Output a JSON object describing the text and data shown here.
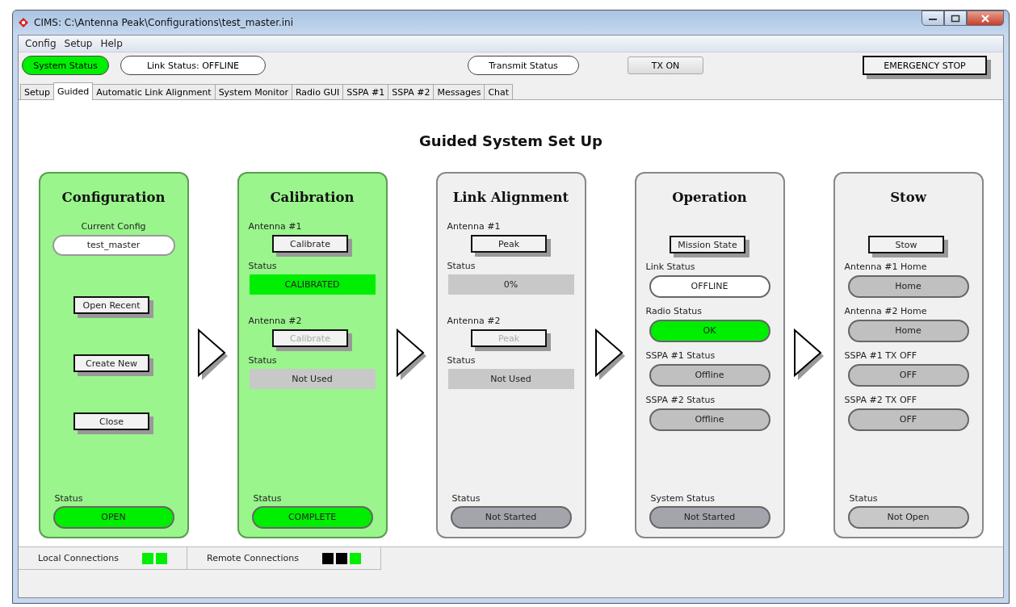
{
  "window": {
    "title": "CIMS: C:\\Antenna Peak\\Configurations\\test_master.ini"
  },
  "menu": [
    "Config",
    "Setup",
    "Help"
  ],
  "toolbar": [
    {
      "kind": "pill",
      "label": "System Status",
      "color": "#00ee00"
    },
    {
      "kind": "pill",
      "label": "Link Status: OFFLINE",
      "color": "#ffffff"
    },
    {
      "kind": "pill",
      "label": "Transmit Status",
      "color": "#ffffff"
    },
    {
      "kind": "button",
      "label": "TX ON"
    },
    {
      "kind": "stop",
      "label": "EMERGENCY STOP"
    }
  ],
  "tabs": [
    {
      "label": "Setup",
      "selected": false
    },
    {
      "label": "Guided",
      "selected": true
    },
    {
      "label": "Automatic Link Alignment",
      "selected": false
    },
    {
      "label": "System Monitor",
      "selected": false
    },
    {
      "label": "Radio GUI",
      "selected": false
    },
    {
      "label": "SSPA #1",
      "selected": false
    },
    {
      "label": "SSPA #2",
      "selected": false
    },
    {
      "label": "Messages",
      "selected": false
    },
    {
      "label": "Chat",
      "selected": false
    }
  ],
  "heading": "Guided System Set Up",
  "panels": [
    {
      "title": "Configuration",
      "complete": true,
      "items": [
        {
          "kind": "label",
          "text": "Current Config"
        },
        {
          "kind": "field",
          "text": "test_master"
        },
        {
          "kind": "button",
          "text": "Open Recent",
          "disabled": false
        },
        {
          "kind": "button",
          "text": "Create New",
          "disabled": false
        },
        {
          "kind": "button",
          "text": "Close",
          "disabled": false
        }
      ],
      "status": {
        "label": "Status",
        "value": "OPEN",
        "color": "#00ee00"
      }
    },
    {
      "title": "Calibration",
      "complete": true,
      "items": [
        {
          "kind": "label",
          "text": "Antenna #1"
        },
        {
          "kind": "button",
          "text": "Calibrate",
          "disabled": false
        },
        {
          "kind": "label",
          "text": "Status"
        },
        {
          "kind": "bar",
          "text": "CALIBRATED",
          "color": "#00ee00"
        },
        {
          "kind": "label",
          "text": "Antenna #2"
        },
        {
          "kind": "button",
          "text": "Calibrate",
          "disabled": true
        },
        {
          "kind": "label",
          "text": "Status"
        },
        {
          "kind": "bar",
          "text": "Not Used",
          "color": "#c8c8c8"
        }
      ],
      "status": {
        "label": "Status",
        "value": "COMPLETE",
        "color": "#00ee00"
      }
    },
    {
      "title": "Link Alignment",
      "complete": false,
      "items": [
        {
          "kind": "label",
          "text": "Antenna #1"
        },
        {
          "kind": "button",
          "text": "Peak",
          "disabled": false
        },
        {
          "kind": "label",
          "text": "Status"
        },
        {
          "kind": "bar",
          "text": "0%",
          "color": "#c8c8c8"
        },
        {
          "kind": "label",
          "text": "Antenna #2"
        },
        {
          "kind": "button",
          "text": "Peak",
          "disabled": true
        },
        {
          "kind": "label",
          "text": "Status"
        },
        {
          "kind": "bar",
          "text": "Not Used",
          "color": "#c8c8c8"
        }
      ],
      "status": {
        "label": "Status",
        "value": "Not Started",
        "color": "#a4a4ac"
      }
    },
    {
      "title": "Operation",
      "complete": false,
      "items": [
        {
          "kind": "button",
          "text": "Mission State",
          "disabled": false
        },
        {
          "kind": "label",
          "text": "Link Status"
        },
        {
          "kind": "pill",
          "text": "OFFLINE",
          "color": "#ffffff"
        },
        {
          "kind": "label",
          "text": "Radio Status"
        },
        {
          "kind": "pill",
          "text": "OK",
          "color": "#00ee00"
        },
        {
          "kind": "label",
          "text": "SSPA #1 Status"
        },
        {
          "kind": "pill",
          "text": "Offline",
          "color": "#c0c0c0"
        },
        {
          "kind": "label",
          "text": "SSPA #2 Status"
        },
        {
          "kind": "pill",
          "text": "Offline",
          "color": "#c0c0c0"
        }
      ],
      "status": {
        "label": "System Status",
        "value": "Not Started",
        "color": "#a4a4ac"
      }
    },
    {
      "title": "Stow",
      "complete": false,
      "items": [
        {
          "kind": "button",
          "text": "Stow",
          "disabled": false
        },
        {
          "kind": "label",
          "text": "Antenna #1 Home"
        },
        {
          "kind": "pill",
          "text": "Home",
          "color": "#c0c0c0"
        },
        {
          "kind": "label",
          "text": "Antenna #2 Home"
        },
        {
          "kind": "pill",
          "text": "Home",
          "color": "#c0c0c0"
        },
        {
          "kind": "label",
          "text": "SSPA #1 TX OFF"
        },
        {
          "kind": "pill",
          "text": "OFF",
          "color": "#c0c0c0"
        },
        {
          "kind": "label",
          "text": "SSPA #2 TX OFF"
        },
        {
          "kind": "pill",
          "text": "OFF",
          "color": "#c0c0c0"
        }
      ],
      "status": {
        "label": "Status",
        "value": "Not Open",
        "color": "#c8c8c8"
      }
    }
  ],
  "status_bar": [
    {
      "label": "Local Connections",
      "indicators": [
        {
          "color": "#00ee00"
        },
        {
          "color": "#00ee00"
        }
      ]
    },
    {
      "label": "Remote Connections",
      "indicators": [
        {
          "color": "#000000"
        },
        {
          "color": "#000000"
        },
        {
          "color": "#00ee00"
        }
      ]
    }
  ]
}
